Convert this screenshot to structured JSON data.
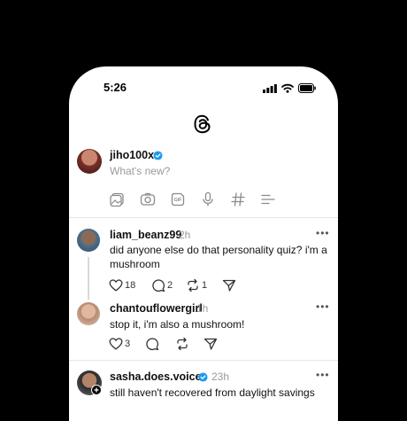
{
  "status_bar": {
    "time": "5:26"
  },
  "composer": {
    "username": "jiho100x",
    "placeholder": "What's new?"
  },
  "posts": [
    {
      "username": "liam_beanz99",
      "ago": "2h",
      "text": "did anyone else do that personality quiz? i'm a mushroom",
      "likes": "18",
      "replies": "2",
      "reposts": "1"
    },
    {
      "username": "chantouflowergirl",
      "ago": "1h",
      "text": "stop it, i'm also a mushroom!",
      "likes": "3"
    },
    {
      "username": "sasha.does.voices",
      "ago": "23h",
      "text": "still haven't recovered from daylight savings"
    }
  ],
  "colors": {
    "background": "#000000",
    "card": "#ffffff",
    "verified": "#1d9bf0",
    "muted": "#9a9a9a"
  },
  "icons": [
    "threads-logo-icon",
    "image-icon",
    "camera-icon",
    "gif-icon",
    "mic-icon",
    "hashtag-icon",
    "list-icon",
    "heart-icon",
    "comment-icon",
    "repost-icon",
    "share-icon",
    "more-icon",
    "verified-icon",
    "follow-plus-icon"
  ]
}
